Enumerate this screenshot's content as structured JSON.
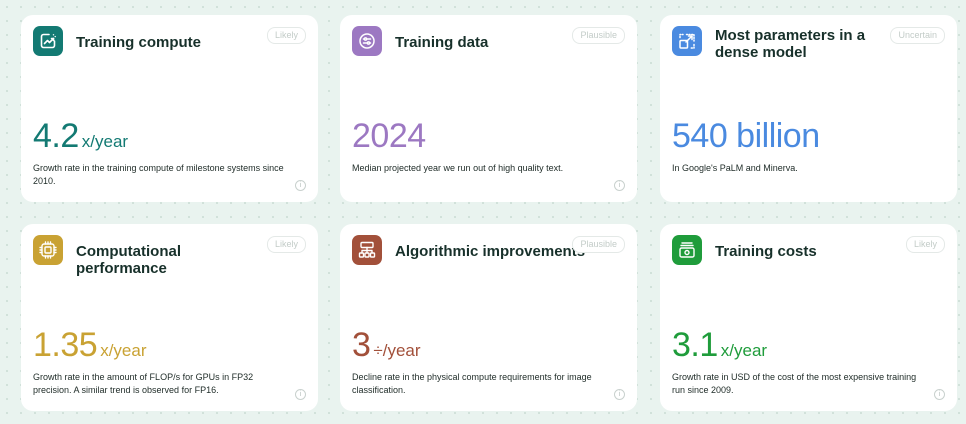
{
  "colors": {
    "teal": "#137a73",
    "purple": "#9c78c2",
    "blue": "#4a8ae0",
    "gold": "#c9a233",
    "rust": "#a2503a",
    "green": "#1f9c3b"
  },
  "cards": [
    {
      "title": "Training compute",
      "badge": "Likely",
      "value": "4.2",
      "unit": "x/year",
      "description": "Growth rate in the training compute of milestone systems since 2010.",
      "icon": "chart-arrow-icon",
      "info": "i"
    },
    {
      "title": "Training data",
      "badge": "Plausible",
      "value": "2024",
      "unit": "",
      "description": "Median projected year we run out of high quality text.",
      "icon": "sliders-icon",
      "info": "i"
    },
    {
      "title": "Most parameters in a dense model",
      "badge": "Uncertain",
      "value": "540 billion",
      "unit": "",
      "description": "In Google's PaLM and Minerva.",
      "icon": "expand-icon",
      "info": "i"
    },
    {
      "title": "Computational performance",
      "badge": "Likely",
      "value": "1.35",
      "unit": "x/year",
      "description": "Growth rate in the amount of FLOP/s for GPUs in FP32 precision. A similar trend is observed for FP16.",
      "icon": "chip-icon",
      "info": "i"
    },
    {
      "title": "Algorithmic improvements",
      "badge": "Plausible",
      "value": "3",
      "unit": "÷/year",
      "description": "Decline rate in the physical compute requirements for image classification.",
      "icon": "hierarchy-icon",
      "info": "i"
    },
    {
      "title": "Training costs",
      "badge": "Likely",
      "value": "3.1",
      "unit": "x/year",
      "description": "Growth rate in USD of the cost of the most expensive training run since 2009.",
      "icon": "wallet-icon",
      "info": "i"
    }
  ]
}
